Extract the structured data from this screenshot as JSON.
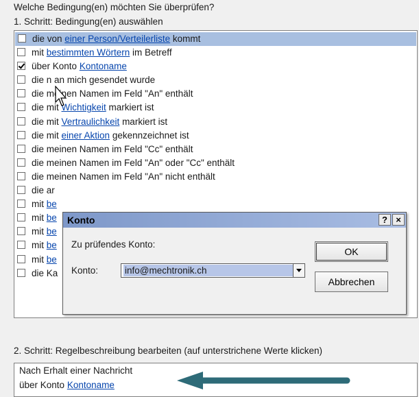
{
  "question": "Welche Bedingung(en) möchten Sie überprüfen?",
  "step1_label": "1. Schritt: Bedingung(en) auswählen",
  "conditions": [
    {
      "pre": "die von ",
      "link": "einer Person/Verteilerliste",
      "post": " kommt",
      "checked": false
    },
    {
      "pre": "mit ",
      "link": "bestimmten Wörtern",
      "post": " im Betreff",
      "checked": false
    },
    {
      "pre": "über Konto ",
      "link": "Kontoname",
      "post": "",
      "checked": true
    },
    {
      "pre": "die n   an mich gesendet wurde",
      "link": "",
      "post": "",
      "checked": false
    },
    {
      "pre": "die meinen Namen im Feld \"An\" enthält",
      "link": "",
      "post": "",
      "checked": false
    },
    {
      "pre": "die mit ",
      "link": "Wichtigkeit",
      "post": " markiert ist",
      "checked": false
    },
    {
      "pre": "die mit ",
      "link": "Vertraulichkeit",
      "post": " markiert ist",
      "checked": false
    },
    {
      "pre": "die mit ",
      "link": "einer Aktion",
      "post": " gekennzeichnet ist",
      "checked": false
    },
    {
      "pre": "die meinen Namen im Feld \"Cc\" enthält",
      "link": "",
      "post": "",
      "checked": false
    },
    {
      "pre": "die meinen Namen im Feld \"An\" oder \"Cc\" enthält",
      "link": "",
      "post": "",
      "checked": false
    },
    {
      "pre": "die meinen Namen im Feld \"An\" nicht enthält",
      "link": "",
      "post": "",
      "checked": false
    },
    {
      "pre": "die ar",
      "link": "",
      "post": "",
      "checked": false
    },
    {
      "pre": "mit ",
      "link": "be",
      "post": "",
      "checked": false
    },
    {
      "pre": "mit ",
      "link": "be",
      "post": "",
      "checked": false
    },
    {
      "pre": "mit ",
      "link": "be",
      "post": "",
      "checked": false
    },
    {
      "pre": "mit ",
      "link": "be",
      "post": "",
      "checked": false
    },
    {
      "pre": "mit ",
      "link": "be",
      "post": "",
      "checked": false
    },
    {
      "pre": "die Ka",
      "link": "",
      "post": "",
      "checked": false
    }
  ],
  "dialog": {
    "title": "Konto",
    "help_button": "?",
    "close_button": "×",
    "prompt": "Zu prüfendes Konto:",
    "field_label": "Konto:",
    "field_value": "info@mechtronik.ch",
    "ok": "OK",
    "cancel": "Abbrechen"
  },
  "step2_label": "2. Schritt: Regelbeschreibung bearbeiten (auf unterstrichene Werte klicken)",
  "description": {
    "line1": "Nach Erhalt einer Nachricht",
    "line2_pre": "über Konto ",
    "line2_link": "Kontoname"
  },
  "colors": {
    "link": "#0645ad",
    "selected_row": "#a8bfe0",
    "arrow": "#2e6b78"
  }
}
